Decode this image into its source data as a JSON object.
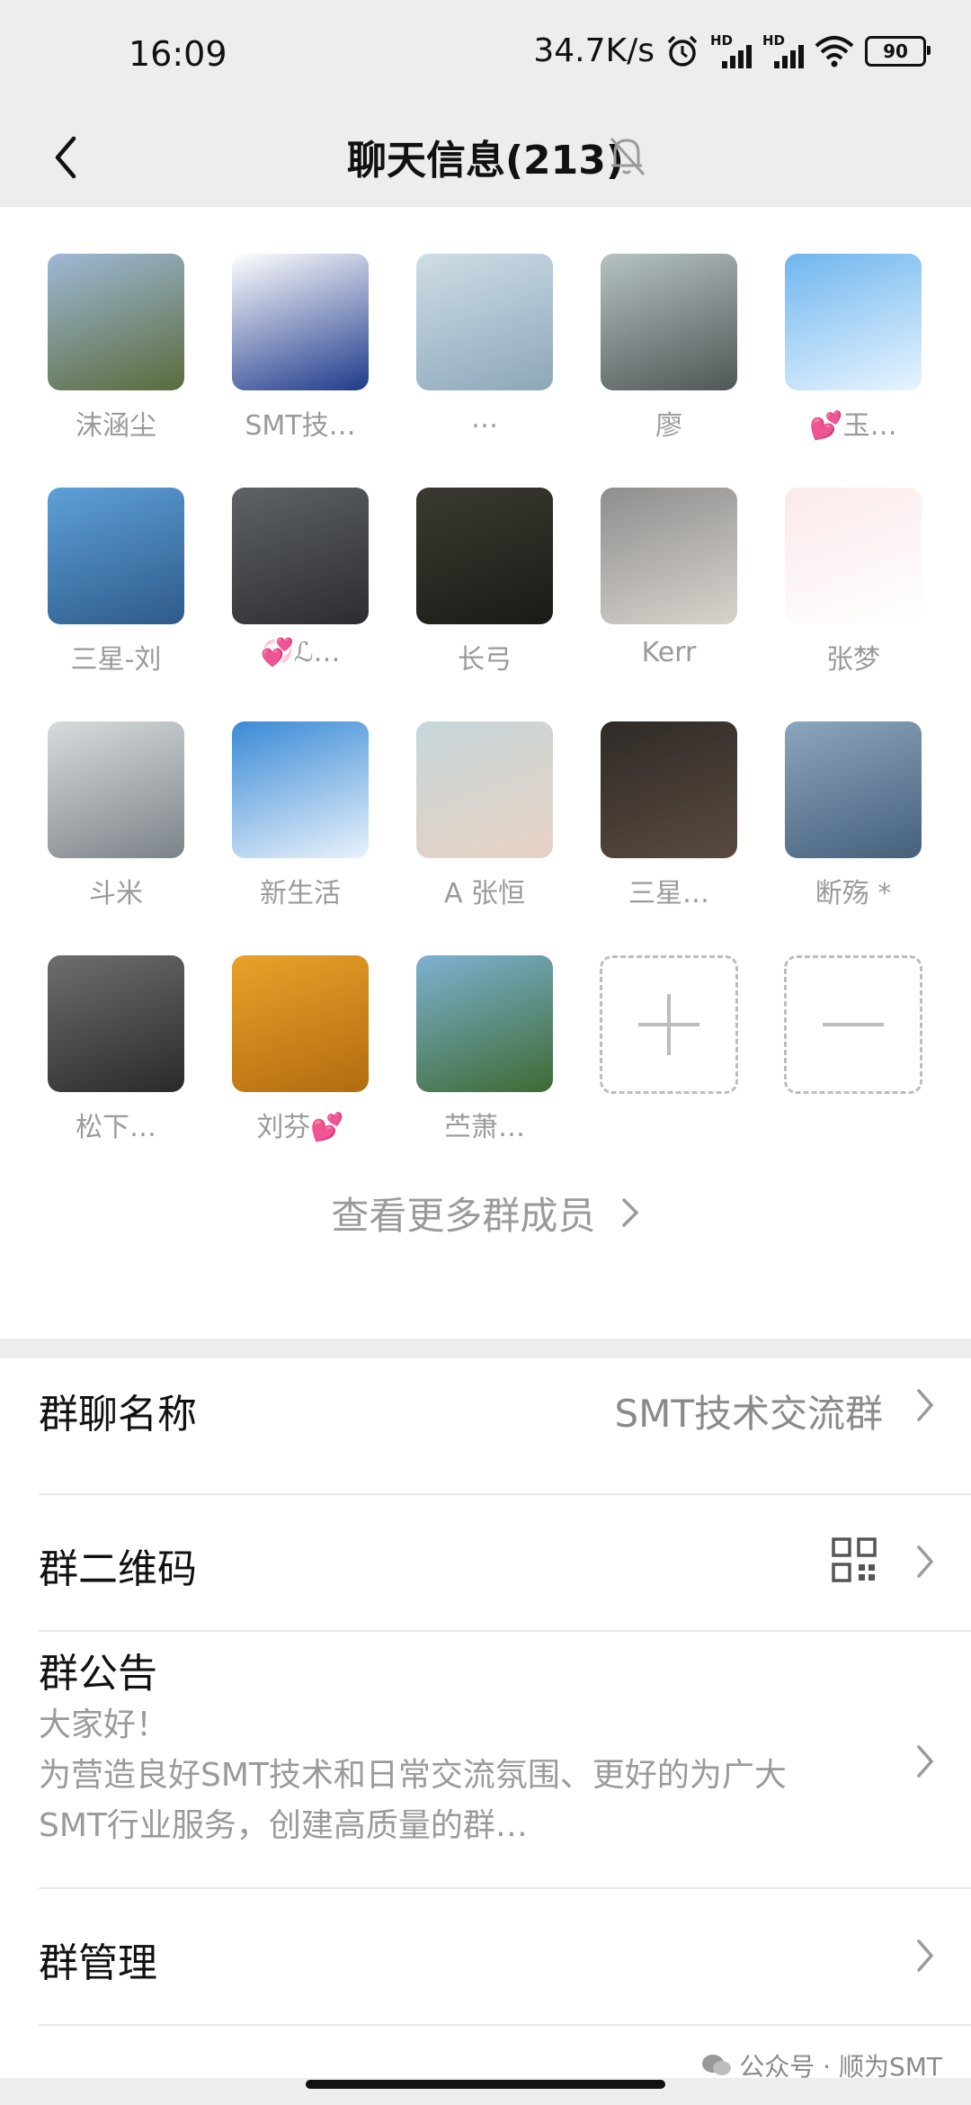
{
  "status_bar": {
    "time": "16:09",
    "speed": "34.7K/s",
    "battery": "90",
    "icons": [
      "alarm-icon",
      "signal-hd-icon",
      "signal-hd-icon",
      "wifi-icon",
      "battery-icon"
    ]
  },
  "nav": {
    "title": "聊天信息(213)",
    "back_icon": "chevron-left-icon",
    "mute_icon": "bell-off-icon"
  },
  "members": [
    {
      "name": "沫涵尘",
      "colors": [
        "#9fb9d6",
        "#5a6b3c"
      ]
    },
    {
      "name": "SMT技…",
      "colors": [
        "#ffffff",
        "#203a8c"
      ]
    },
    {
      "name": "…",
      "colors": [
        "#cfdde6",
        "#8ca7ba"
      ]
    },
    {
      "name": "廖",
      "colors": [
        "#b7c2c3",
        "#4f5756"
      ]
    },
    {
      "name": "💕玉…",
      "colors": [
        "#6fb6ee",
        "#e8f4ff"
      ]
    },
    {
      "name": "三星-刘",
      "colors": [
        "#5ea0d8",
        "#2e5a8a"
      ]
    },
    {
      "name": "💞ℒ…",
      "colors": [
        "#5f6266",
        "#2b2d30"
      ]
    },
    {
      "name": "长弓",
      "colors": [
        "#3b3a32",
        "#1b1a15"
      ]
    },
    {
      "name": "Kerr",
      "colors": [
        "#8e8e8e",
        "#d9d3cc"
      ]
    },
    {
      "name": "张梦",
      "colors": [
        "#fbe9ea",
        "#ffffff"
      ]
    },
    {
      "name": "斗米",
      "colors": [
        "#d7dbde",
        "#7c8388"
      ]
    },
    {
      "name": "新生活",
      "colors": [
        "#3a8ad6",
        "#e9f2fb"
      ]
    },
    {
      "name": "A 张恒",
      "colors": [
        "#c7d6db",
        "#e7d2c2"
      ]
    },
    {
      "name": "三星…",
      "colors": [
        "#2f2b28",
        "#5a4a3f"
      ]
    },
    {
      "name": "断殇 *",
      "colors": [
        "#8da6bf",
        "#45607b"
      ]
    },
    {
      "name": "松下…",
      "colors": [
        "#6f6e6c",
        "#2a2a2a"
      ]
    },
    {
      "name": "刘芬💕",
      "colors": [
        "#e9a22a",
        "#b26b10"
      ]
    },
    {
      "name": "苎萧…",
      "colors": [
        "#7eb1d2",
        "#3d6b33"
      ]
    }
  ],
  "add_member_icon": "plus-icon",
  "remove_member_icon": "minus-icon",
  "more_members": "查看更多群成员",
  "settings": {
    "group_name_label": "群聊名称",
    "group_name_value": "SMT技术交流群",
    "qr_label": "群二维码",
    "qr_icon": "qr-code-icon",
    "notice_label": "群公告",
    "notice_line1": "大家好！",
    "notice_line2": "为营造良好SMT技术和日常交流氛围、更好的为广大",
    "notice_line3": "SMT行业服务，创建高质量的群…",
    "manage_label": "群管理"
  },
  "watermark": "公众号 · 顺为SMT"
}
